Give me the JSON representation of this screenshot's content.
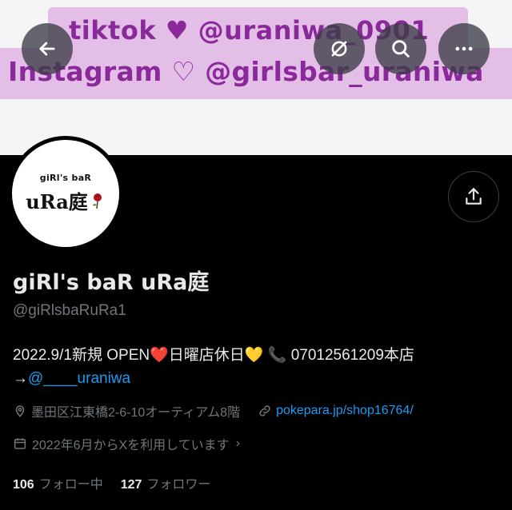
{
  "banner": {
    "line1": "tiktok ♥ @uraniwa_0901",
    "line2": "Instagram ♡ @girlsbar_uraniwa"
  },
  "avatar": {
    "top_text": "giRl's baR",
    "main_text": "uRa庭"
  },
  "profile": {
    "display_name": "giRl's baR uRa庭",
    "handle": "@giRlsbaRuRa1",
    "bio_part1": "2022.9/1新規 OPEN",
    "bio_heart": "❤️",
    "bio_part2": "日曜店休日",
    "bio_yellow_heart": "💛",
    "bio_phone": "📞",
    "bio_part3": "07012561209本店",
    "bio_arrow": "→",
    "bio_mention": "@____uraniwa",
    "location": "墨田区江東橋2-6-10オーティアム8階",
    "website": "pokepara.jp/shop16764/",
    "joined": "2022年6月からXを利用しています",
    "following_count": "106",
    "following_label": "フォロー中",
    "followers_count": "127",
    "followers_label": "フォロワー"
  },
  "icons": {
    "back": "arrow-left-icon",
    "grok": "grok-icon",
    "search": "search-icon",
    "more": "more-dots-icon",
    "share": "share-icon",
    "location": "location-pin-icon",
    "link": "link-icon",
    "calendar": "calendar-icon"
  },
  "colors": {
    "banner_band": "#e3bfe7",
    "banner_text": "#8a2a9a",
    "link": "#1d9bf0",
    "secondary_text": "#71767b"
  }
}
